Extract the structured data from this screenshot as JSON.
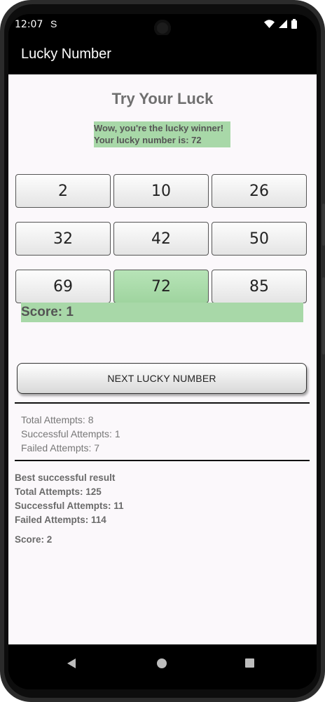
{
  "status_bar": {
    "time": "12:07",
    "notification_glyph": "S",
    "icons": [
      "wifi-icon",
      "signal-icon",
      "battery-icon"
    ]
  },
  "app_bar": {
    "title": "Lucky Number"
  },
  "main": {
    "heading": "Try Your Luck",
    "message_line1": "Wow, you're the lucky winner!",
    "message_line2": "Your lucky number is: 72",
    "numbers": [
      "2",
      "10",
      "26",
      "32",
      "42",
      "50",
      "69",
      "72",
      "85"
    ],
    "lucky_value": "72",
    "score": "Score: 1",
    "next_button": "NEXT LUCKY NUMBER"
  },
  "stats": {
    "total": "Total Attempts: 8",
    "successful": "Successful Attempts: 1",
    "failed": "Failed Attempts:  7"
  },
  "best": {
    "title": "Best successful result",
    "total": "Total Attempts: 125",
    "successful": "Successful Attempts: 11",
    "failed": "Failed Attempts:  114",
    "score": "Score: 2"
  },
  "colors": {
    "highlight": "#a8d8a8",
    "app_bar": "#000000",
    "background": "#fbf8fb"
  }
}
